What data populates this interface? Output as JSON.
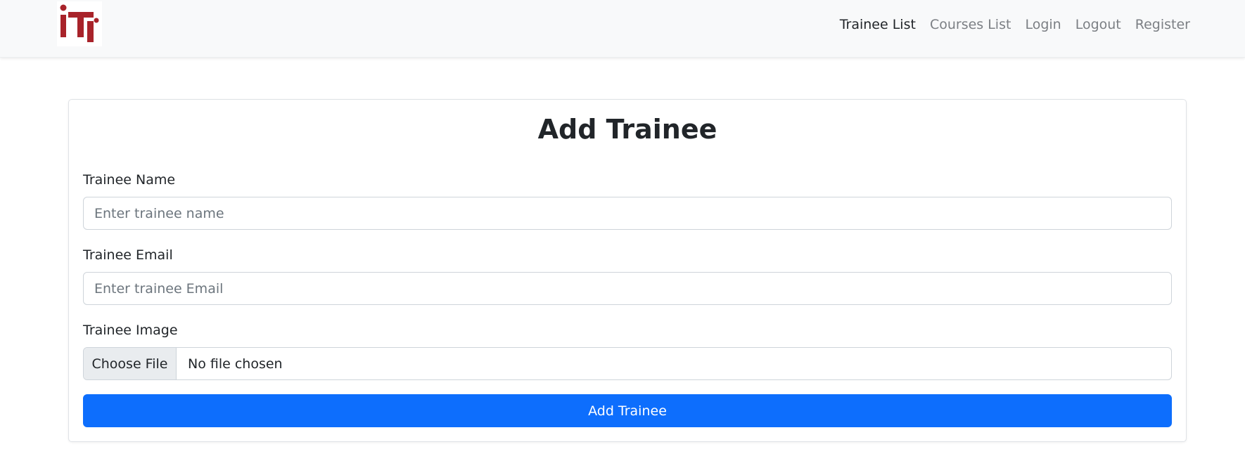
{
  "navbar": {
    "logo": "iti-logo",
    "links": [
      {
        "label": "Trainee List"
      },
      {
        "label": "Courses List"
      },
      {
        "label": "Login"
      },
      {
        "label": "Logout"
      },
      {
        "label": "Register"
      }
    ],
    "active_link": "Trainee List"
  },
  "form": {
    "title": "Add Trainee",
    "name_label": "Trainee Name",
    "name_value": "",
    "name_placeholder": "Enter trainee name",
    "email_label": "Trainee Email",
    "email_value": "",
    "email_placeholder": "Enter trainee Email",
    "image_label": "Trainee Image",
    "file_button": "Choose File",
    "file_status": "No file chosen",
    "submit_label": "Add Trainee"
  },
  "colors": {
    "primary": "#0d6efd",
    "logo_red": "#a8232a",
    "navbar_bg": "#f8f9fa"
  }
}
